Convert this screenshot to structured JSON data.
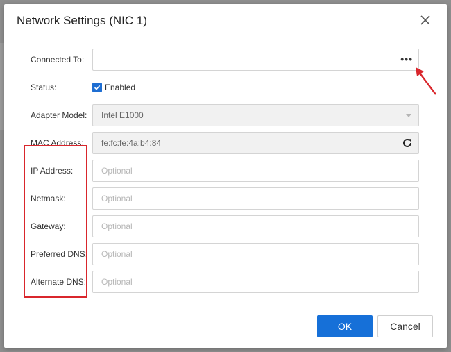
{
  "dialog": {
    "title": "Network Settings (NIC 1)"
  },
  "fields": {
    "connected_to": {
      "label": "Connected To:",
      "value": ""
    },
    "status": {
      "label": "Status:",
      "checkbox_label": "Enabled",
      "checked": true
    },
    "adapter_model": {
      "label": "Adapter Model:",
      "value": "Intel E1000"
    },
    "mac_address": {
      "label": "MAC Address:",
      "value": "fe:fc:fe:4a:b4:84"
    },
    "ip_address": {
      "label": "IP Address:",
      "placeholder": "Optional"
    },
    "netmask": {
      "label": "Netmask:",
      "placeholder": "Optional"
    },
    "gateway": {
      "label": "Gateway:",
      "placeholder": "Optional"
    },
    "preferred_dns": {
      "label": "Preferred DNS:",
      "placeholder": "Optional"
    },
    "alternate_dns": {
      "label": "Alternate DNS:",
      "placeholder": "Optional"
    }
  },
  "buttons": {
    "ok": "OK",
    "cancel": "Cancel",
    "browse": "•••"
  },
  "icons": {
    "close": "close-icon",
    "dropdown": "chevron-down-icon",
    "refresh": "refresh-icon",
    "checkbox": "check-icon"
  },
  "colors": {
    "primary": "#1670d8",
    "annotation": "#d9262c",
    "checkbox": "#1e6ed2"
  }
}
